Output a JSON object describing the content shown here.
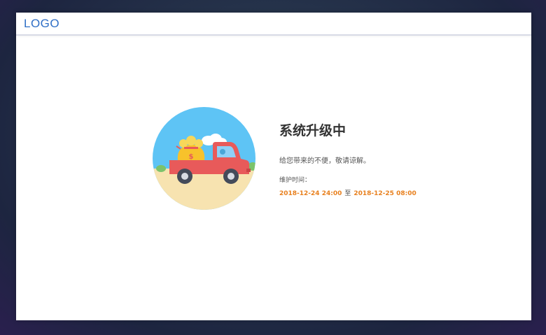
{
  "header": {
    "logo_text": "LOGO"
  },
  "main": {
    "title": "系统升级中",
    "subtitle": "给您带来的不便，敬请谅解。",
    "maintenance_label": "维护时间：",
    "start_time": "2018-12-24  24:00",
    "separator": "至",
    "end_time": "2018-12-25  08:00"
  },
  "colors": {
    "logo": "#2f6fc6",
    "time_accent": "#e8801e",
    "sky": "#5ec4f5",
    "ground": "#f7e3b0",
    "truck": "#e85a5a"
  },
  "icons": {
    "illustration": "delivery-truck-with-money-bag"
  }
}
